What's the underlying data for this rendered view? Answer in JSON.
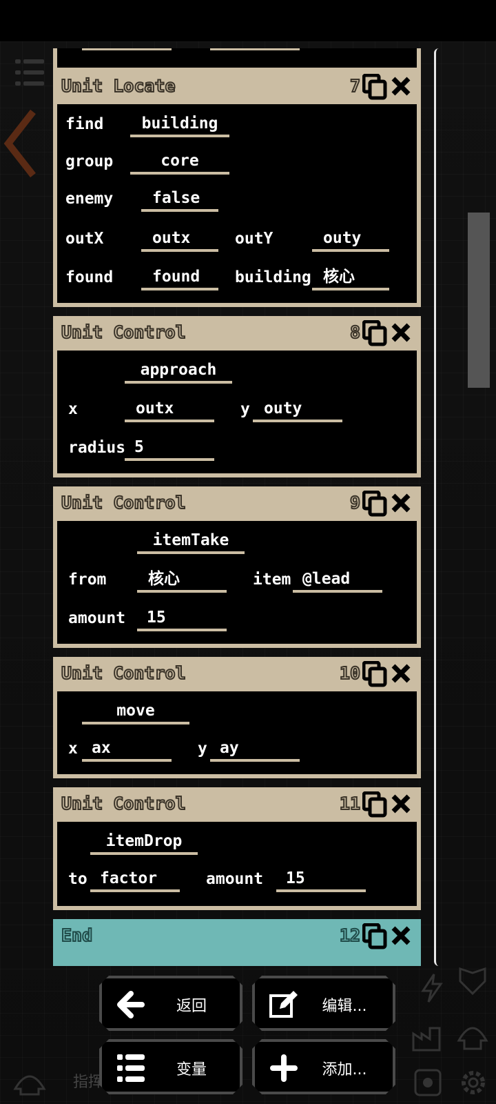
{
  "blocks": [
    {
      "id": "unit-locate",
      "title": "Unit Locate",
      "index": "7",
      "rows": {
        "find_label": "find",
        "find_value": "building",
        "group_label": "group",
        "group_value": "core",
        "enemy_label": "enemy",
        "enemy_value": "false",
        "outx_label": "outX",
        "outx_value": "outx",
        "outy_label": "outY",
        "outy_value": "outy",
        "found_label": "found",
        "found_value": "found",
        "building_label": "building",
        "building_value": "核心"
      }
    },
    {
      "id": "unit-control-1",
      "title": "Unit Control",
      "index": "8",
      "rows": {
        "action": "approach",
        "x_label": "x",
        "x_value": "outx",
        "y_label": "y",
        "y_value": "outy",
        "radius_label": "radius",
        "radius_value": "5"
      }
    },
    {
      "id": "unit-control-2",
      "title": "Unit Control",
      "index": "9",
      "rows": {
        "action": "itemTake",
        "from_label": "from",
        "from_value": "核心",
        "item_label": "item",
        "item_value": "@lead",
        "amount_label": "amount",
        "amount_value": "15"
      }
    },
    {
      "id": "unit-control-3",
      "title": "Unit Control",
      "index": "10",
      "rows": {
        "action": "move",
        "x_label": "x",
        "x_value": "ax",
        "y_label": "y",
        "y_value": "ay"
      }
    },
    {
      "id": "unit-control-4",
      "title": "Unit Control",
      "index": "11",
      "rows": {
        "action": "itemDrop",
        "to_label": "to",
        "to_value": "factor",
        "amount_label": "amount",
        "amount_value": "15"
      }
    },
    {
      "id": "end",
      "title": "End",
      "index": "12"
    }
  ],
  "buttons": {
    "back": "返回",
    "edit": "编辑...",
    "variables": "变量",
    "add": "添加..."
  },
  "hint_text": "指挥",
  "colors": {
    "block_header": "#cbbda3",
    "end_header": "#6fb8b5",
    "button_border": "#4a4a4a"
  }
}
